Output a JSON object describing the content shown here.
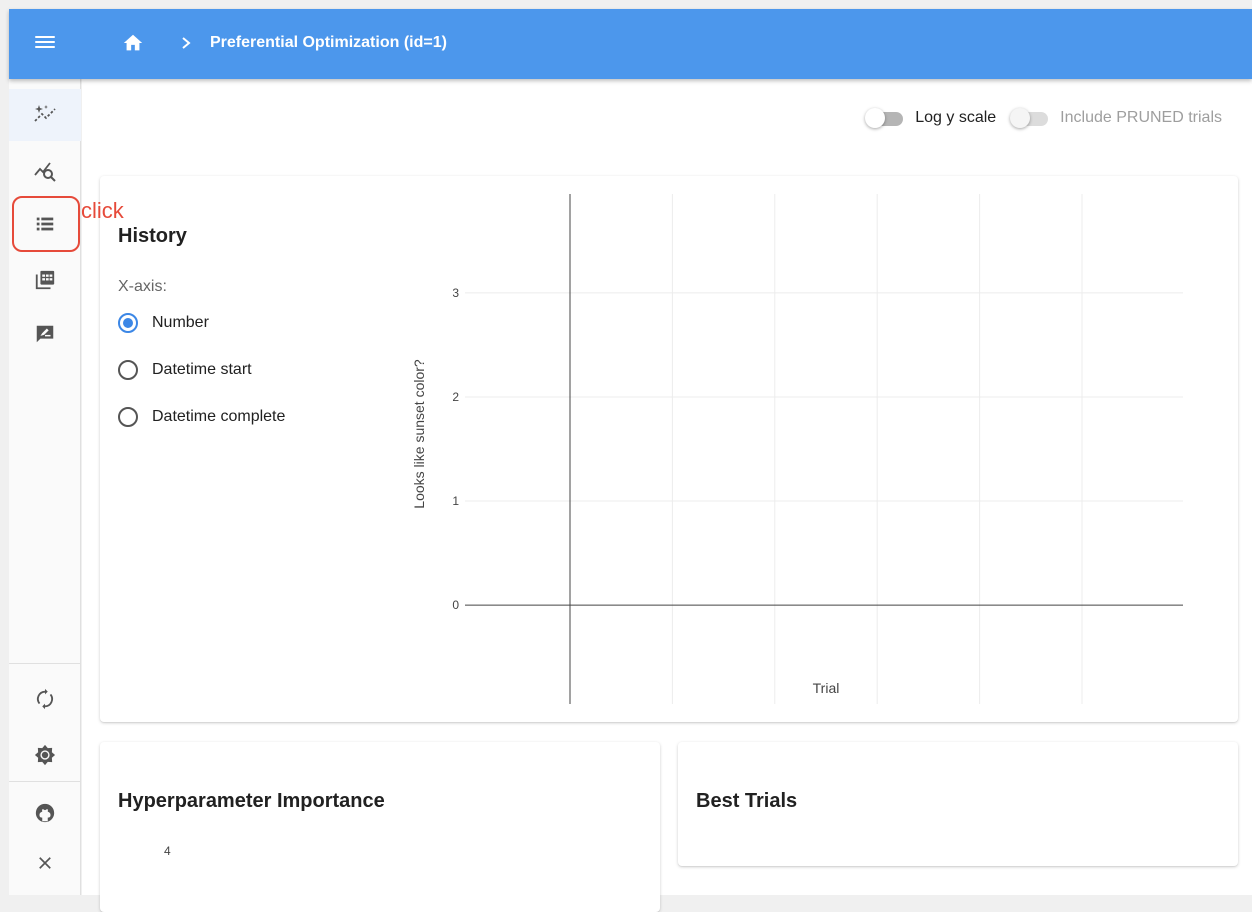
{
  "header": {
    "title": "Preferential Optimization (id=1)"
  },
  "annotation": {
    "text": "click"
  },
  "toggles": {
    "log_y_label": "Log y scale",
    "include_pruned_label": "Include PRUNED trials"
  },
  "history": {
    "title": "History",
    "xaxis_label": "X-axis:",
    "options": [
      "Number",
      "Datetime start",
      "Datetime complete"
    ],
    "selected": "Number"
  },
  "chart_data": {
    "type": "scatter",
    "title": "",
    "xlabel": "Trial",
    "ylabel": "Looks like sunset color?",
    "yticks": [
      "0",
      "1",
      "2",
      "3"
    ],
    "ylim": [
      -0.95,
      3.95
    ],
    "series": [],
    "grid": true
  },
  "importance": {
    "title": "Hyperparameter Importance",
    "tick": "4"
  },
  "best_trials": {
    "title": "Best Trials"
  },
  "icons": {
    "nav": [
      "sparkle-chart-icon",
      "chart-search-icon",
      "list-icon",
      "table-icon",
      "note-edit-icon"
    ],
    "footer": [
      "sync-icon",
      "brightness-icon",
      "github-icon",
      "close-icon"
    ]
  }
}
